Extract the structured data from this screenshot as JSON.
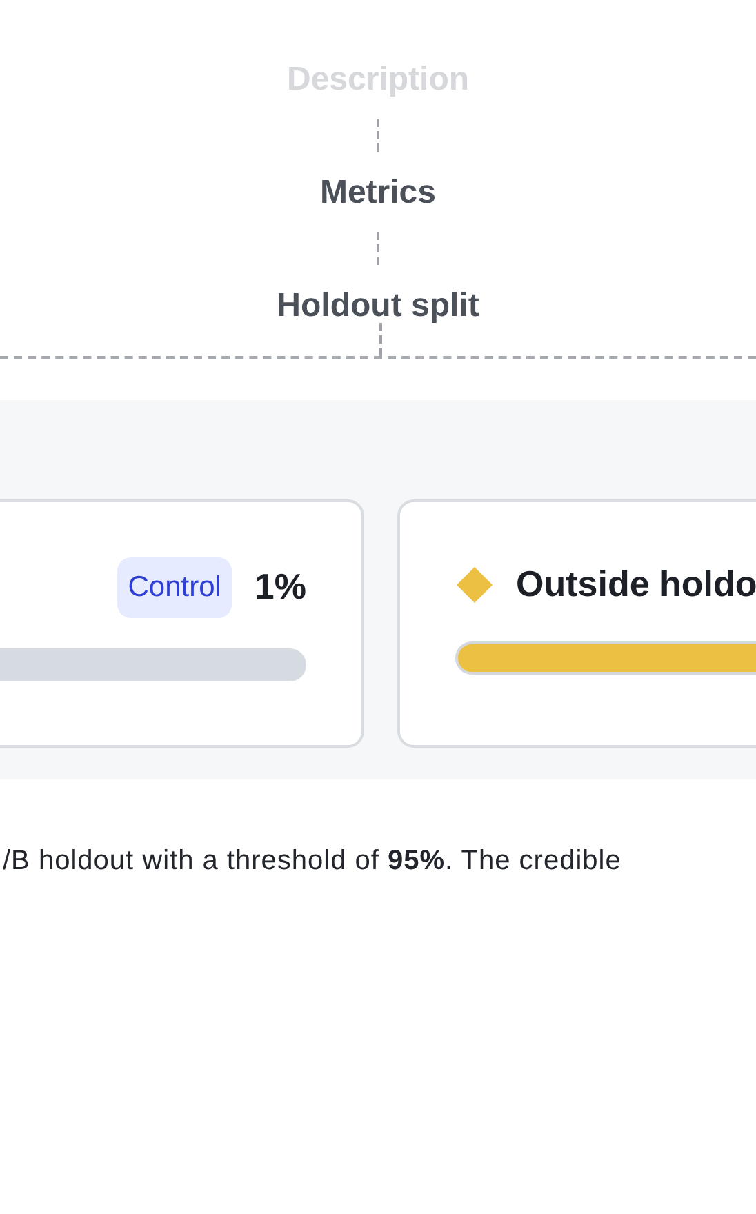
{
  "steps": [
    {
      "label": "Description",
      "dimmed": true
    },
    {
      "label": "Metrics",
      "dimmed": false
    },
    {
      "label": "Holdout split",
      "dimmed": false
    }
  ],
  "groups": [
    {
      "kind": "control",
      "badge": "Control",
      "percent": "1%",
      "color": "#d6dae1"
    },
    {
      "kind": "outside",
      "title": "Outside holdo",
      "color": "#ecc143"
    }
  ],
  "summary": "/B holdout with a threshold of **95%**. The credible"
}
